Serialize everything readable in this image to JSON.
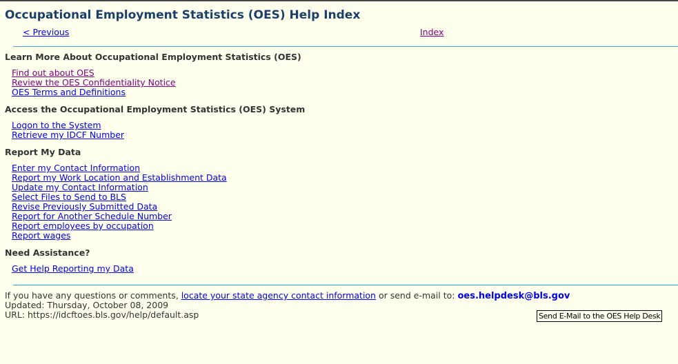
{
  "page": {
    "title": "Occupational Employment Statistics (OES) Help Index",
    "nav": {
      "previous": "< Previous",
      "index": "Index"
    }
  },
  "sections": [
    {
      "heading": "Learn More About Occupational Employment Statistics (OES)",
      "links": [
        "Find out about OES",
        "Review the OES Confidentiality Notice",
        "OES Terms and Definitions"
      ]
    },
    {
      "heading": "Access the Occupational Employment Statistics (OES) System",
      "links": [
        "Logon to the System",
        "Retrieve my IDCF Number"
      ]
    },
    {
      "heading": "Report My Data",
      "links": [
        "Enter my Contact Information",
        "Report my Work Location and Establishment Data",
        "Update my Contact Information",
        "Select Files to Send to BLS",
        "Revise Previously Submitted Data",
        "Report for Another Schedule Number",
        "Report employees by occupation",
        "Report wages"
      ]
    },
    {
      "heading": "Need Assistance?",
      "links": [
        "Get Help Reporting my Data"
      ]
    }
  ],
  "footer": {
    "question_prefix": "If you have any questions or comments, ",
    "state_link": "locate your state agency contact information",
    "email_prefix": " or send e-mail to: ",
    "email": "oes.helpdesk@bls.gov",
    "updated": "Updated: Thursday, October 08, 2009",
    "url": "URL: https://idcftoes.bls.gov/help/default.asp"
  },
  "tooltip": "Send E-Mail to the OES Help Desk",
  "colors": {
    "background": "#FFFFEE",
    "title": "#1B3F6B",
    "link": "#0000EE",
    "visited_link": "#800080",
    "rule": "#5B9BD5"
  }
}
